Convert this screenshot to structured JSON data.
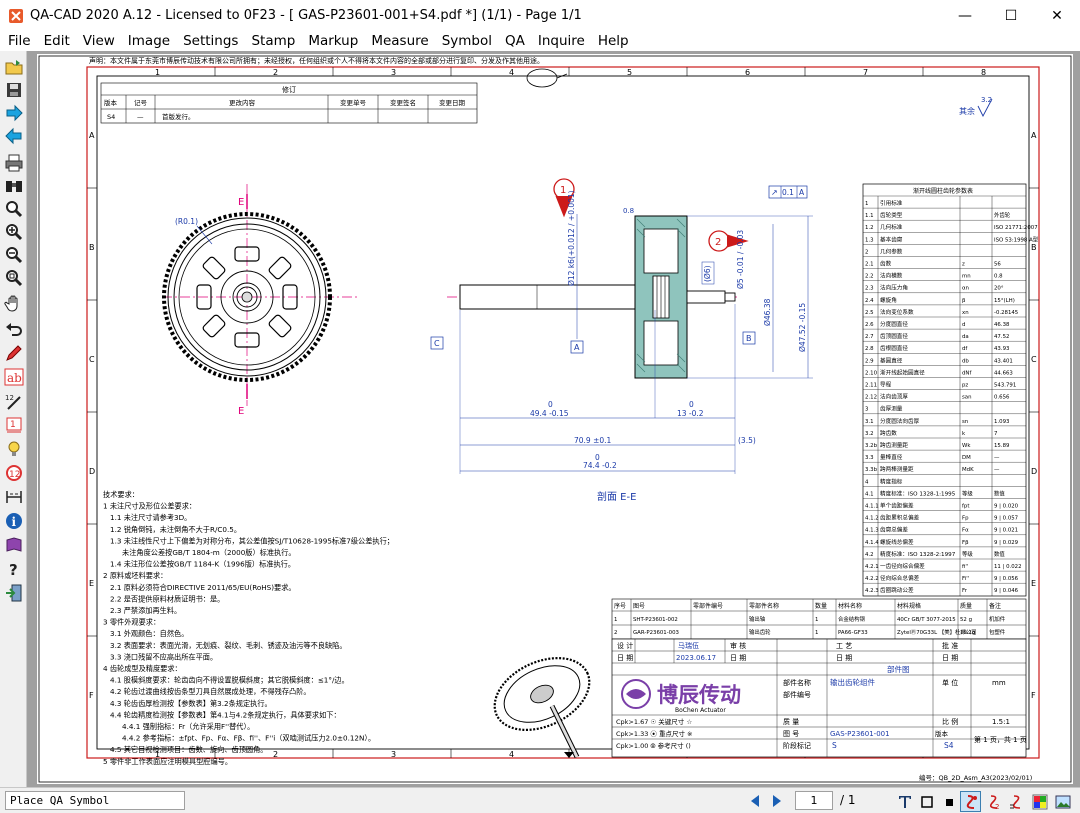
{
  "window": {
    "title": "QA-CAD 2020 A.12 - Licensed to 0F23  -  [ GAS-P23601-001+S4.pdf *] (1/1)  -  Page 1/1",
    "minimize": "—",
    "maximize": "☐",
    "close": "✕"
  },
  "menu": [
    "File",
    "Edit",
    "View",
    "Image",
    "Settings",
    "Stamp",
    "Markup",
    "Measure",
    "Symbol",
    "QA",
    "Inquire",
    "Help"
  ],
  "toolbar_icons": [
    "open-folder-icon",
    "save-icon",
    "next-icon",
    "previous-icon",
    "print-icon",
    "binoculars-icon",
    "zoom-icon",
    "zoom-in-icon",
    "zoom-out-icon",
    "zoom-window-icon",
    "pan-hand-icon",
    "undo-icon",
    "pen-icon",
    "text-ab-icon",
    "numbering-icon",
    "rectangle-stamp-icon",
    "lightbulb-icon",
    "qa-balloon-icon",
    "dimension-icon",
    "info-icon",
    "book-icon",
    "help-icon",
    "exit-icon"
  ],
  "drawing": {
    "header_notice": "声明：本文件属于东莞市博辰传动技术有限公司所拥有；未经授权，任何组织或个人不得将本文件内容的全部或部分进行复印、分发及作其他用途。",
    "zone_cols": [
      "1",
      "2",
      "3",
      "4",
      "5",
      "6",
      "7",
      "8"
    ],
    "zone_rows": [
      "A",
      "B",
      "C",
      "D",
      "E",
      "F"
    ],
    "revision_table": {
      "title": "修订",
      "headers": [
        "版本",
        "记号",
        "更改内容",
        "变更单号",
        "变更签名",
        "变更日期"
      ],
      "row": [
        "S4",
        "—",
        "首版发行。",
        "",
        "",
        ""
      ]
    },
    "roughness": {
      "label": "其余",
      "value": "3.2"
    },
    "section_label": "剖面 E-E",
    "section_mark": "E",
    "radius_label": "(R0.1)",
    "datums": {
      "a": "A",
      "b": "B",
      "c": "C"
    },
    "balloons": [
      "1",
      "2"
    ],
    "dims": {
      "d1": "Ø12 k6(+0.012 / +0.001)",
      "d2": "Ø5 -0.01 / -0.03",
      "d3": "(Ø6)",
      "d4": "Ø46.38",
      "d5": "Ø47.52 -0.15",
      "len1_a": "0",
      "len1_b": "49.4 -0.15",
      "len2_a": "0",
      "len2_b": "13 -0.2",
      "len3": "70.9 ±0.1",
      "len4": "(3.5)",
      "len5_a": "0",
      "len5_b": "74.4 -0.2",
      "runout_sym": "↗",
      "runout_val": "0.1",
      "runout_datum": "A",
      "rough_local": "0.8"
    },
    "gear_params": {
      "title": "渐开线圆柱齿轮参数表",
      "rows": [
        [
          "1",
          "引用标准",
          "",
          ""
        ],
        [
          "1.1",
          "齿轮类型",
          "",
          "外齿轮"
        ],
        [
          "1.2",
          "几何标准",
          "",
          "ISO 21771:2007"
        ],
        [
          "1.3",
          "基本齿廓",
          "",
          "ISO 53:1998 A型"
        ],
        [
          "2",
          "几何参数",
          "",
          ""
        ],
        [
          "2.1",
          "齿数",
          "z",
          "56"
        ],
        [
          "2.2",
          "法向模数",
          "mn",
          "0.8"
        ],
        [
          "2.3",
          "法向压力角",
          "αn",
          "20°"
        ],
        [
          "2.4",
          "螺旋角",
          "β",
          "15°(LH)"
        ],
        [
          "2.5",
          "法向变位系数",
          "xn",
          "-0.28145"
        ],
        [
          "2.6",
          "分度圆直径",
          "d",
          "46.38"
        ],
        [
          "2.7",
          "齿顶圆直径",
          "da",
          "47.52"
        ],
        [
          "2.8",
          "齿根圆直径",
          "df",
          "43.93"
        ],
        [
          "2.9",
          "基圆直径",
          "db",
          "43.401"
        ],
        [
          "2.10",
          "渐开线起始圆直径",
          "dNf",
          "44.663"
        ],
        [
          "2.11",
          "导程",
          "pz",
          "543.791"
        ],
        [
          "2.12",
          "法向齿顶厚",
          "san",
          "0.656"
        ],
        [
          "3",
          "齿厚测量",
          "",
          ""
        ],
        [
          "3.1",
          "分度圆法向齿厚",
          "sn",
          "1.093"
        ],
        [
          "3.2",
          "跨齿数",
          "k",
          "7"
        ],
        [
          "3.2b",
          "跨齿测量距",
          "Wk",
          "15.89"
        ],
        [
          "3.3",
          "量棒直径",
          "DM",
          "—"
        ],
        [
          "3.3b",
          "跨两棒测量距",
          "MdK",
          "—"
        ],
        [
          "4",
          "精度指标",
          "",
          ""
        ],
        [
          "4.1",
          "精度标准：ISO 1328-1:1995",
          "等级",
          "数值"
        ],
        [
          "4.1.1",
          "单个齿距偏差",
          "fpt",
          "9 | 0.020"
        ],
        [
          "4.1.2",
          "齿距累积总偏差",
          "Fp",
          "9 | 0.057"
        ],
        [
          "4.1.3",
          "齿廓总偏差",
          "Fα",
          "9 | 0.021"
        ],
        [
          "4.1.4",
          "螺旋线总偏差",
          "Fβ",
          "9 | 0.029"
        ],
        [
          "4.2",
          "精度标准：ISO 1328-2:1997",
          "等级",
          "数值"
        ],
        [
          "4.2.1",
          "一齿径向综合偏差",
          "fi''",
          "11 | 0.022"
        ],
        [
          "4.2.2",
          "径向综合总偏差",
          "Fi''",
          "9 | 0.056"
        ],
        [
          "4.2.3",
          "齿圈跳动公差",
          "Fr",
          "9 | 0.046"
        ]
      ]
    },
    "tech_req": [
      "技术要求：",
      "1 未注尺寸及形位公差要求：",
      "1.1 未注尺寸请参考3D。",
      "1.2 锐角倒钝，未注倒角不大于R/C0.5。",
      "1.3 未注线性尺寸上下偏差为对称分布，其公差值按SJ/T10628-1995标准7级公差执行；",
      "未注角度公差按GB/T 1804-m（2000版）标准执行。",
      "1.4 未注形位公差按GB/T 1184-K（1996版）标准执行。",
      "2 原料或坯料要求：",
      "2.1 原料必须符合DIRECTIVE 2011/65/EU(RoHS)要求。",
      "2.2 是否提供原料材质证明书：是。",
      "2.3 严禁添加再生料。",
      "3 零件外观要求：",
      "3.1 外观颜色：自然色。",
      "3.2 表面要求：表面光滑，无划痕、裂纹、毛刺、锈迹及油污等不良缺陷。",
      "3.3 浇口残留不应高出所在平面。",
      "4 齿轮成型及精度要求：",
      "4.1 股模斜度要求：轮齿齿向不得设置脱模斜度；其它脱模斜度：≤1°/边。",
      "4.2 轮齿过渡曲线按齿条型刀具自然展成处理，不得残存凸阶。",
      "4.3 轮齿齿厚检测按【参数表】第3.2条规定执行。",
      "4.4 轮齿精度检测按【参数表】第4.1与4.2条规定执行，具体要求如下：",
      "4.4.1 强制指标：Fr（允许采用F''替代）。",
      "4.4.2 参考指标：±fpt、Fp、Fα、Fβ、fi''、F''i（双啮测试压力2.0±0.12N）。",
      "4.5 其它目视检测项目：齿数、旋向、齿顶圆角。",
      "5 零件非工作表面应注明模具型腔编号。"
    ],
    "bom": {
      "headers": [
        "序号",
        "图号",
        "零部件编号",
        "零部件名称",
        "数量",
        "材料名称",
        "材料规格",
        "质量",
        "备注"
      ],
      "rows": [
        [
          "1",
          "SHT-P23601-002",
          "",
          "输出轴",
          "1",
          "合金结构钢",
          "40Cr GB/T 3077-2015",
          "52 g",
          "机加件"
        ],
        [
          "2",
          "GAR-P23601-003",
          "",
          "输出齿轮",
          "1",
          "PA66-GF33",
          "ZytelⓇ70G33L 【美】杜邦公司",
          "16.1g",
          "包塑件"
        ]
      ]
    },
    "title_block": {
      "design_label": "设    计",
      "designer": "马瑞伍",
      "review_label": "审    核",
      "process_label": "工    艺",
      "approve_label": "批    准",
      "date_label": "日    期",
      "date_value": "2023.06.17",
      "category": "部件图",
      "part_name_label": "部件名称",
      "part_name": "输出齿轮组件",
      "part_no_label": "部件编号",
      "unit_label": "单    位",
      "unit": "mm",
      "quality_label": "质    量",
      "scale_label": "比    例",
      "scale": "1.5:1",
      "drawing_no_label": "图    号",
      "drawing_no": "GAS-P23601-001",
      "version_label": "版本",
      "version": "S4",
      "stage_label": "阶段标记",
      "stage": "S",
      "sheet": "第 1 页，共 1 页",
      "company_cn": "博辰传动",
      "company_en": "BoChen Actuator",
      "cpk1": "Cpk>1.67 ☉ 关键尺寸 ☆",
      "cpk2": "Cpk>1.33 ⦿ 重点尺寸 ※",
      "cpk3": "Cpk>1.00 ⦾ 参考尺寸 ()",
      "footer": "编号：QB_2D_Asm_A3(2023/02/01)"
    }
  },
  "status": {
    "message": "Place QA Symbol",
    "page": "1",
    "total": "/ 1"
  },
  "colors": {
    "border_red": "#cc1a1a",
    "accent_blue": "#1b3aa8",
    "center_magenta": "#e0007a",
    "teal_hatch": "#5aaaa0"
  }
}
